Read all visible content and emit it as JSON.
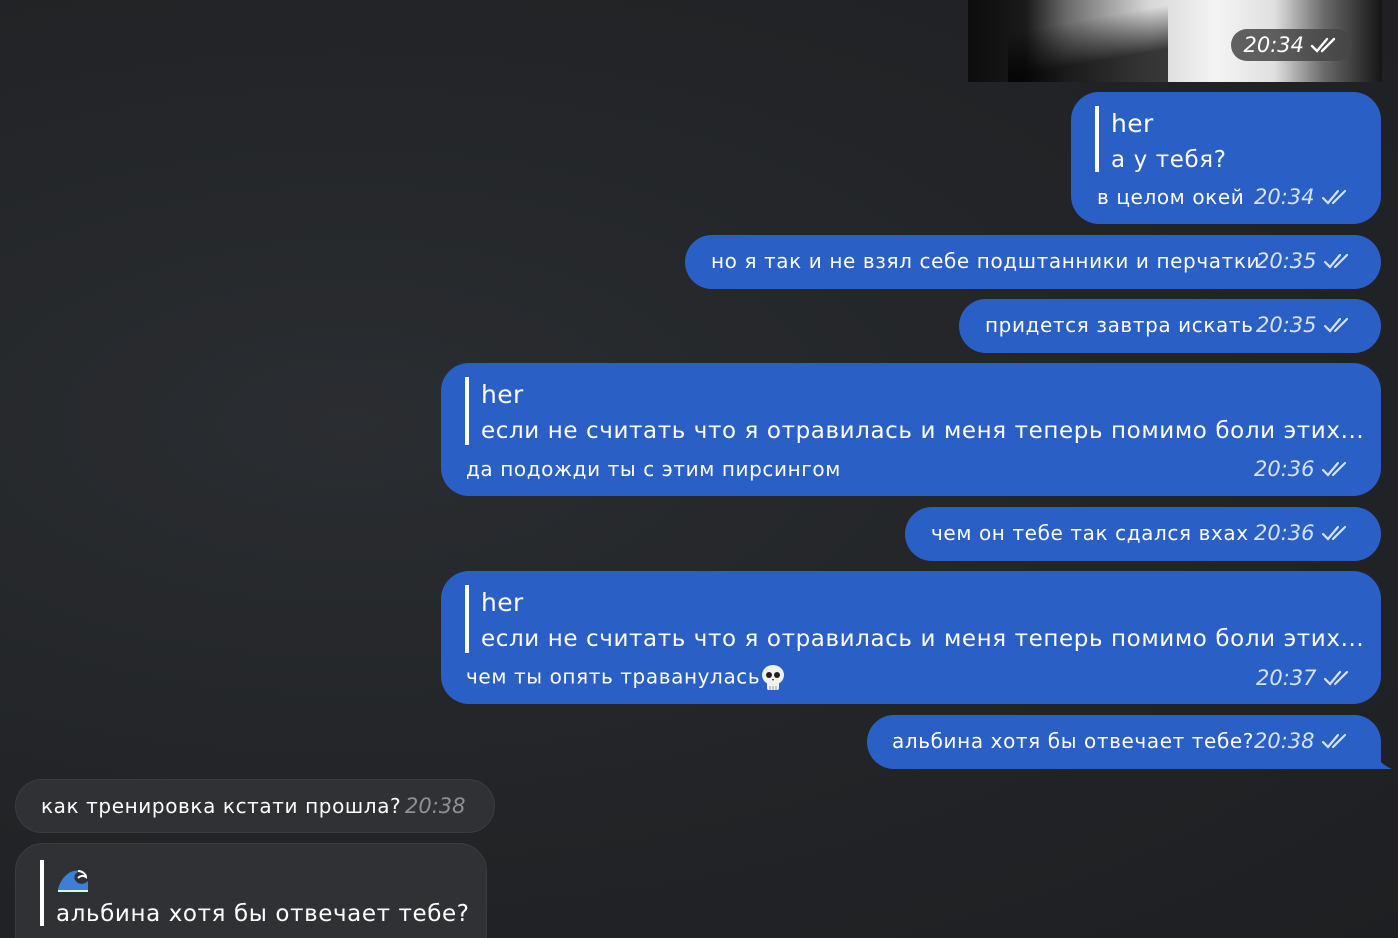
{
  "colors": {
    "outgoing_bubble": "#2a5fc5",
    "incoming_bubble": "#2f3134",
    "background": "#202225"
  },
  "photo_message": {
    "time": "20:34",
    "status_icon": "double-check-icon"
  },
  "messages": [
    {
      "reply_author": "her",
      "reply_text": "а у тебя?",
      "text": "в целом окей",
      "time": "20:34"
    },
    {
      "text": "но я так и не взял себе подштанники и перчатки",
      "time": "20:35"
    },
    {
      "text": "придется завтра искать",
      "time": "20:35"
    },
    {
      "reply_author": "her",
      "reply_text": "если не считать что я отравилась и меня теперь помимо боли этих...",
      "text": "да подожди ты с этим пирсингом",
      "time": "20:36"
    },
    {
      "text": "чем он тебе так сдался вхах",
      "time": "20:36"
    },
    {
      "reply_author": "her",
      "reply_text": "если не считать что я отравилась и меня теперь помимо боли этих...",
      "text": "чем ты опять траванулась",
      "emoji": "skull-emoji",
      "time": "20:37"
    },
    {
      "text": "альбина хотя бы отвечает тебе?",
      "time": "20:38"
    }
  ],
  "incoming": [
    {
      "text": "как тренировка кстати прошла?",
      "time": "20:38"
    },
    {
      "reply_author_icon": "wave-emoji",
      "reply_text": "альбина хотя бы отвечает тебе?"
    }
  ]
}
